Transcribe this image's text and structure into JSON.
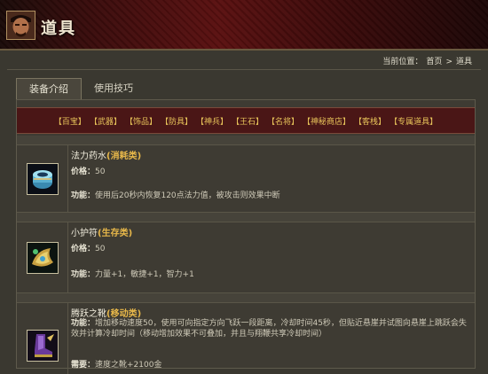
{
  "header": {
    "title": "道具"
  },
  "breadcrumb": {
    "prefix": "当前位置：",
    "home": "首页",
    "sep": ">",
    "current": "道具"
  },
  "tabs": [
    {
      "label": "装备介绍",
      "active": true
    },
    {
      "label": "使用技巧",
      "active": false
    }
  ],
  "categories": [
    "【百宝】",
    "【武器】",
    "【饰品】",
    "【防具】",
    "【神兵】",
    "【王石】",
    "【名将】",
    "【神秘商店】",
    "【客栈】",
    "【专属道具】"
  ],
  "items": [
    {
      "name": "法力药水",
      "type": "(消耗类)",
      "price_label": "价格：",
      "price": "50",
      "func_label": "功能：",
      "func": "使用后20秒内恢复120点法力值，被攻击则效果中断",
      "icon": "mana-potion-icon"
    },
    {
      "name": "小护符",
      "type": "(生存类)",
      "price_label": "价格：",
      "price": "50",
      "func_label": "功能：",
      "func": "力量+1，敏捷+1，智力+1",
      "icon": "amulet-icon"
    },
    {
      "name": "腾跃之靴",
      "type": "(移动类)",
      "func_label": "功能：",
      "func": "增加移动速度50，使用可向指定方向飞跃一段距离，冷却时间45秒，但贴近悬崖并试图向悬崖上跳跃会失效并计算冷却时间（移动增加效果不可叠加，并且与翔鞭共享冷却时间）",
      "need_label": "需要：",
      "need": "速度之靴+2100金",
      "icon": "boots-icon"
    }
  ],
  "colors": {
    "banner": "#5a1010",
    "category_bar": "#4a1616",
    "category_text": "#e8c45a",
    "type_text": "#e8b84a"
  }
}
